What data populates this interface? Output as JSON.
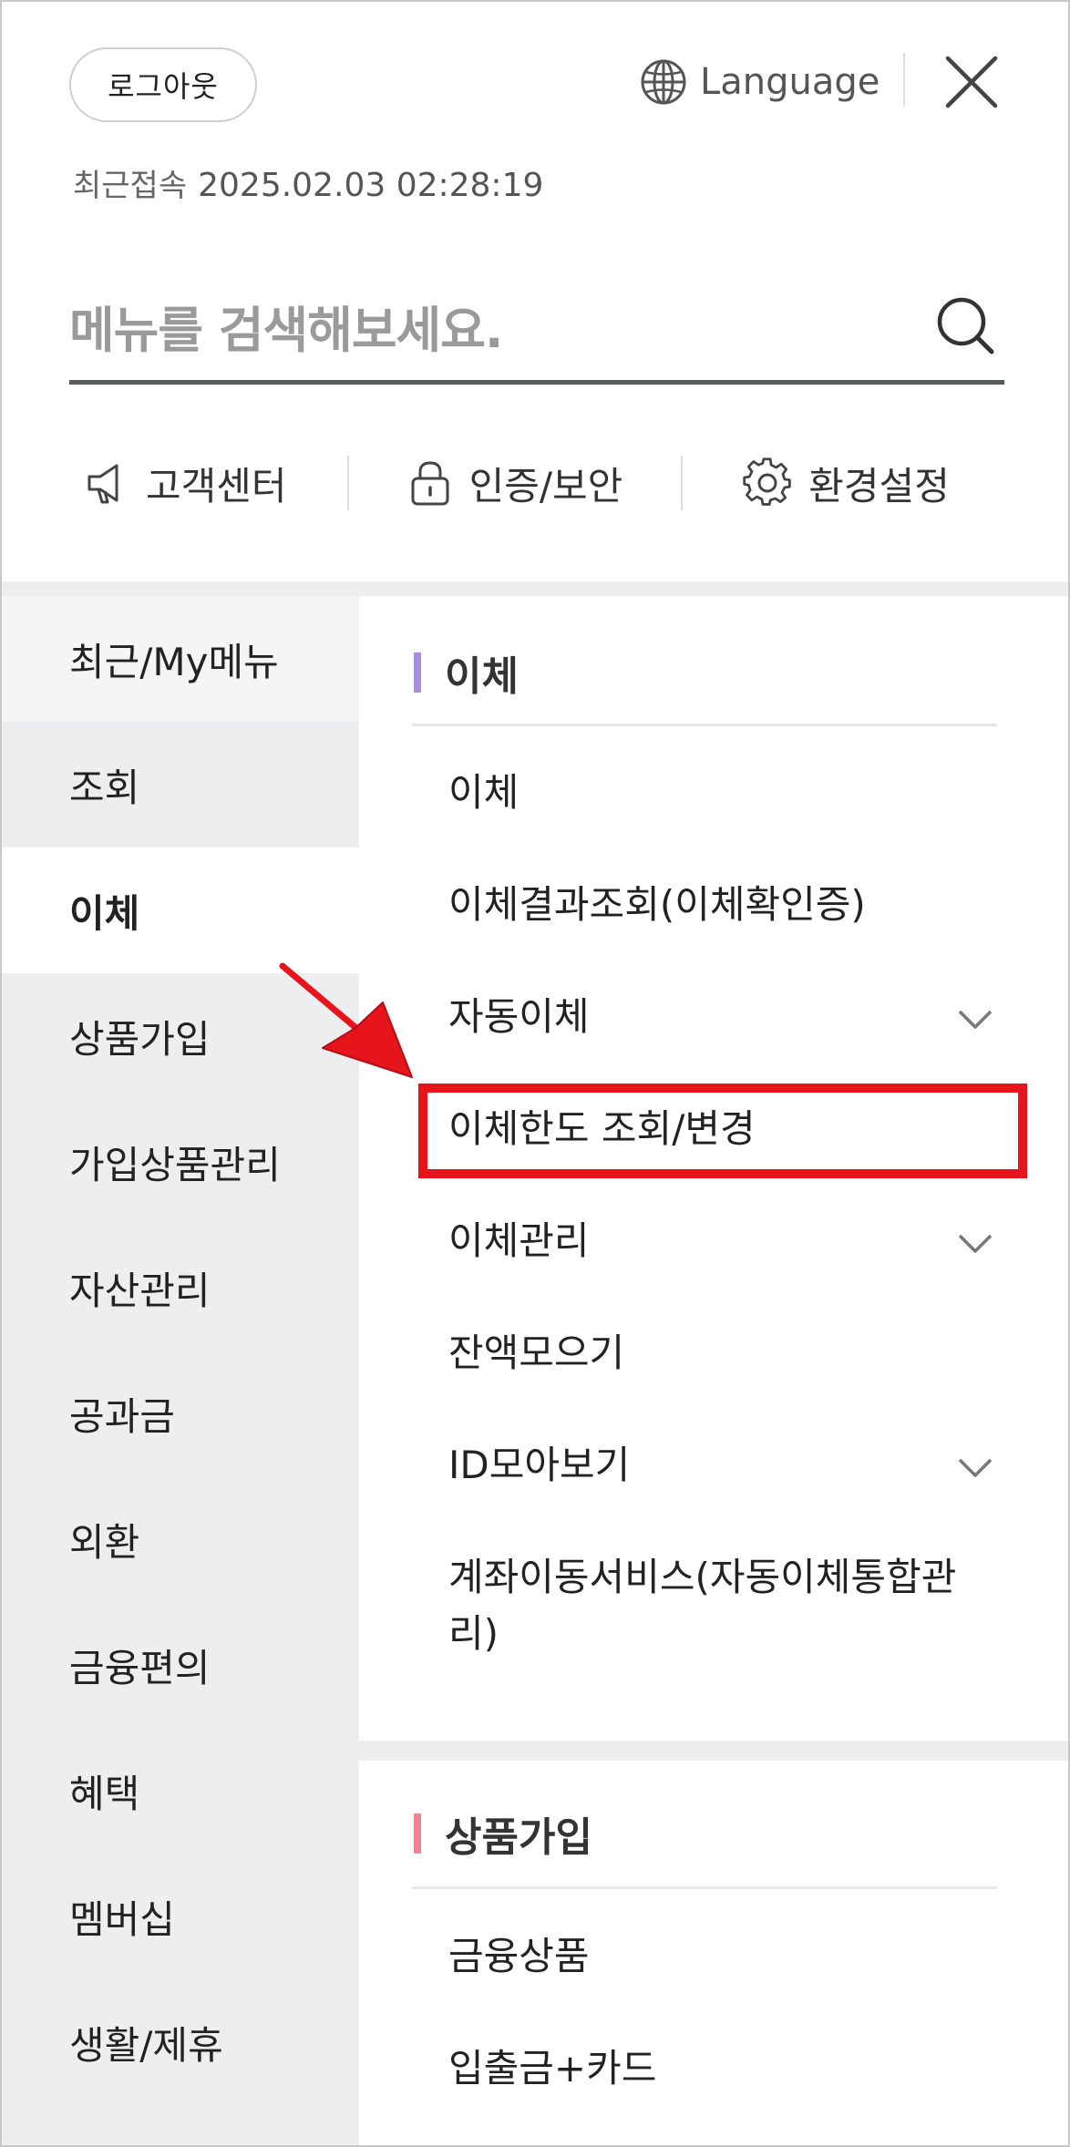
{
  "header": {
    "logout_label": "로그아웃",
    "language_label": "Language",
    "last_access_label": "최근접속",
    "last_access_time": "2025.02.03 02:28:19"
  },
  "search": {
    "placeholder": "메뉴를 검색해보세요."
  },
  "quick_links": [
    {
      "label": "고객센터",
      "icon": "megaphone-icon"
    },
    {
      "label": "인증/보안",
      "icon": "lock-icon"
    },
    {
      "label": "환경설정",
      "icon": "gear-icon"
    }
  ],
  "left_menu": {
    "items": [
      {
        "label": "최근/My메뉴"
      },
      {
        "label": "조회"
      },
      {
        "label": "이체"
      },
      {
        "label": "상품가입"
      },
      {
        "label": "가입상품관리"
      },
      {
        "label": "자산관리"
      },
      {
        "label": "공과금"
      },
      {
        "label": "외환"
      },
      {
        "label": "금융편의"
      },
      {
        "label": "혜택"
      },
      {
        "label": "멤버십"
      },
      {
        "label": "생활/제휴"
      }
    ],
    "active": "이체"
  },
  "sections": [
    {
      "title": "이체",
      "accent": "#a98be0",
      "items": [
        {
          "label": "이체"
        },
        {
          "label": "이체결과조회(이체확인증)"
        },
        {
          "label": "자동이체"
        },
        {
          "label": "이체한도 조회/변경"
        },
        {
          "label": "이체관리"
        },
        {
          "label": "잔액모으기"
        },
        {
          "label": "ID모아보기"
        },
        {
          "label": "계좌이동서비스(자동이체통합관리)"
        }
      ]
    },
    {
      "title": "상품가입",
      "accent": "#f0848e",
      "items": [
        {
          "label": "금융상품"
        },
        {
          "label": "입출금+카드"
        }
      ]
    }
  ],
  "annotation": {
    "highlight_color": "#e8141b"
  }
}
